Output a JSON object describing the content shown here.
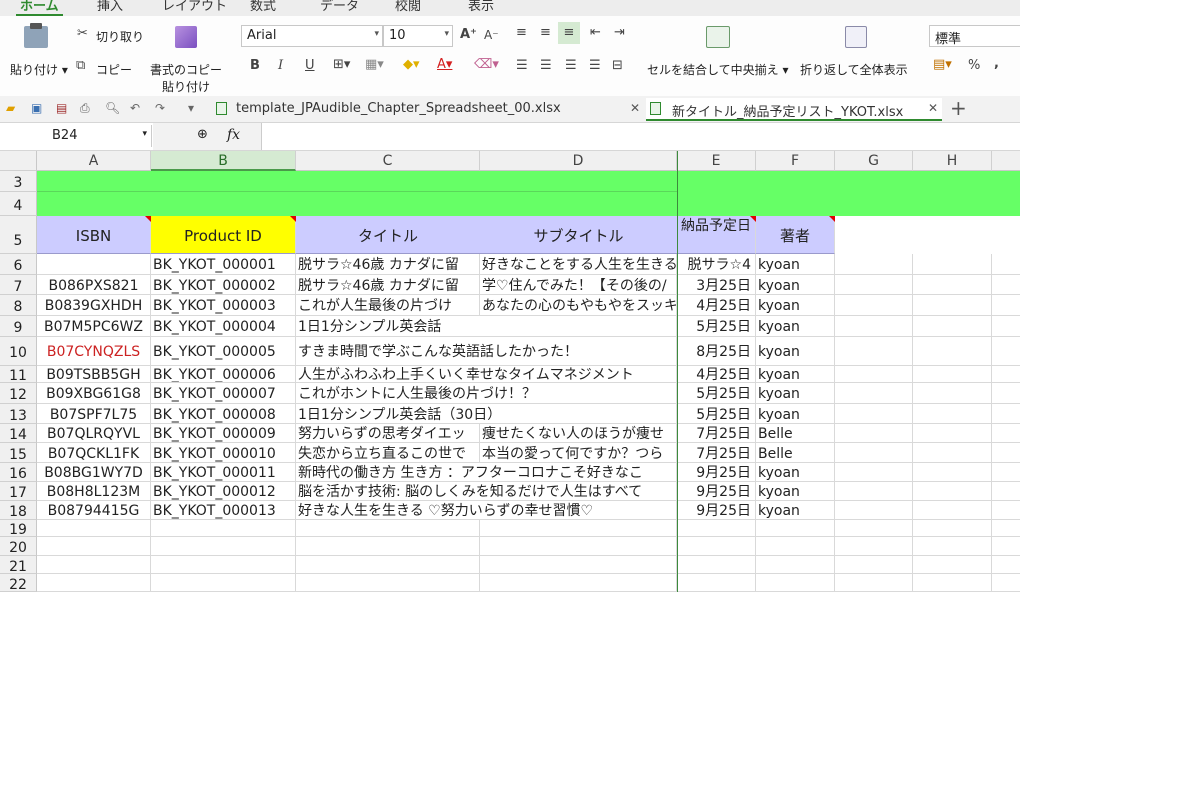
{
  "ribbon_tabs": [
    "ホーム",
    "挿入",
    "レイアウト",
    "数式",
    "データ",
    "校閲",
    "表示"
  ],
  "clipboard": {
    "paste_label": "貼り付け",
    "cut_label": "切り取り",
    "copy_label": "コピー",
    "format_copy_label_1": "書式のコピー",
    "format_copy_label_2": "貼り付け"
  },
  "font": {
    "name": "Arial",
    "size": "10",
    "bold": "B",
    "italic": "I",
    "underline": "U"
  },
  "alignment": {
    "merge_label": "セルを結合して中央揃え",
    "wrap_label": "折り返して全体表示"
  },
  "number_format": {
    "value": "標準",
    "percent": "%",
    "comma": ","
  },
  "file_tabs": [
    {
      "name": "template_JPAudible_Chapter_Spreadsheet_00.xlsx",
      "active": false
    },
    {
      "name": "新タイトル_納品予定リスト_YKOT.xlsx",
      "active": true
    }
  ],
  "formula_bar": {
    "name_box": "B24",
    "fx": "fx",
    "formula": ""
  },
  "columns": [
    "A",
    "B",
    "C",
    "D",
    "E",
    "F",
    "G",
    "H"
  ],
  "selected_column": "B",
  "header_row": {
    "row": "5",
    "cells": [
      "ISBN",
      "Product ID",
      "タイトル",
      "サブタイトル",
      "納品予定日",
      "著者"
    ]
  },
  "band_rows": [
    "3",
    "4"
  ],
  "rows": [
    {
      "row": "6",
      "isbn": "",
      "pid": "BK_YKOT_000001",
      "title": "脱サラ☆46歳 カナダに留",
      "subtitle": "好きなことをする人生を生きる",
      "date": "脱サラ☆4",
      "author": "kyoan"
    },
    {
      "row": "7",
      "isbn": "B086PXS821",
      "pid": "BK_YKOT_000002",
      "title": "脱サラ☆46歳 カナダに留",
      "subtitle": "学♡住んでみた！【その後の/",
      "date": "3月25日",
      "author": "kyoan"
    },
    {
      "row": "8",
      "isbn": "B0839GXHDH",
      "pid": "BK_YKOT_000003",
      "title": "これが人生最後の片づけ",
      "subtitle": "あなたの心のもやもやをスッキ",
      "date": "4月25日",
      "author": "kyoan"
    },
    {
      "row": "9",
      "isbn": "B07M5PC6WZ",
      "pid": "BK_YKOT_000004",
      "title": "1日1分シンプル英会話",
      "subtitle": "",
      "date": "5月25日",
      "author": "kyoan"
    },
    {
      "row": "10",
      "isbn": "B07CYNQZLS",
      "pid": "BK_YKOT_000005",
      "title": "すきま時間で学ぶこんな英語話したかった！",
      "subtitle": "",
      "date": "8月25日",
      "author": "kyoan",
      "isbn_color": "#cc2222"
    },
    {
      "row": "11",
      "isbn": "B09TSBB5GH",
      "pid": "BK_YKOT_000006",
      "title": "人生がふわふわ上手くいく幸せなタイムマネジメント",
      "subtitle": "",
      "date": "4月25日",
      "author": "kyoan"
    },
    {
      "row": "12",
      "isbn": "B09XBG61G8",
      "pid": "BK_YKOT_000007",
      "title": "これがホントに人生最後の片づけ！？",
      "subtitle": "",
      "date": "5月25日",
      "author": "kyoan"
    },
    {
      "row": "13",
      "isbn": "B07SPF7L75",
      "pid": "BK_YKOT_000008",
      "title": "1日1分シンプル英会話（30日）",
      "subtitle": "",
      "date": "5月25日",
      "author": "kyoan"
    },
    {
      "row": "14",
      "isbn": "B07QLRQYVL",
      "pid": "BK_YKOT_000009",
      "title": "努力いらずの思考ダイエッ",
      "subtitle": "痩せたくない人のほうが痩せ",
      "date": "7月25日",
      "author": "Belle"
    },
    {
      "row": "15",
      "isbn": "B07QCKL1FK",
      "pid": "BK_YKOT_000010",
      "title": "失恋から立ち直るこの世で",
      "subtitle": "本当の愛って何ですか？つら",
      "date": "7月25日",
      "author": "Belle"
    },
    {
      "row": "16",
      "isbn": "B08BG1WY7D",
      "pid": "BK_YKOT_000011",
      "title": "新時代の働き方 生き方 ：アフターコロナこそ好きなこ",
      "subtitle": "",
      "date": "9月25日",
      "author": "kyoan"
    },
    {
      "row": "17",
      "isbn": "B08H8L123M",
      "pid": "BK_YKOT_000012",
      "title": "脳を活かす技術: 脳のしくみを知るだけで人生はすべて",
      "subtitle": "",
      "date": "9月25日",
      "author": "kyoan"
    },
    {
      "row": "18",
      "isbn": "B08794415G",
      "pid": "BK_YKOT_000013",
      "title": "好きな人生を生きる ♡努力いらずの幸せ習慣♡",
      "subtitle": "",
      "date": "9月25日",
      "author": "kyoan"
    }
  ],
  "empty_rows": [
    "20",
    "21",
    "22"
  ],
  "colors": {
    "accent_green": "#2f8a2f",
    "band_green": "#66ff66",
    "header_lavender": "#ccccff",
    "product_id_yellow": "#ffff00",
    "comment_red": "#e00000"
  },
  "icons": [
    "paste-icon",
    "scissors-icon",
    "copy-icon",
    "format-painter-icon",
    "grow-font-icon",
    "shrink-font-icon",
    "border-icon",
    "fill-color-icon",
    "font-color-icon",
    "clear-icon",
    "align-icons",
    "merge-icon",
    "wrap-icon",
    "currency-icon",
    "open-icon",
    "save-icon",
    "print-icon",
    "undo-icon",
    "redo-icon",
    "excel-file-icon",
    "close-icon",
    "add-tab-icon",
    "zoom-icon"
  ]
}
